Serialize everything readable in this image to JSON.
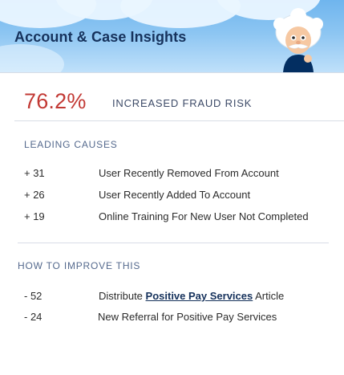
{
  "header": {
    "title": "Account & Case Insights",
    "mascot": "einstein-mascot-icon"
  },
  "metric": {
    "value": "76.2%",
    "label": "INCREASED FRAUD RISK",
    "color": "#c23934"
  },
  "leading_causes": {
    "title": "LEADING CAUSES",
    "items": [
      {
        "score": "+ 31",
        "text": "User Recently Removed From Account"
      },
      {
        "score": "+ 26",
        "text": "User Recently Added To Account"
      },
      {
        "score": "+ 19",
        "text": "Online Training For New User Not Completed"
      }
    ]
  },
  "improve": {
    "title": "HOW TO IMPROVE THIS",
    "items": [
      {
        "score": "- 52",
        "prefix": "Distribute ",
        "link": "Positive Pay Services",
        "suffix": " Article"
      },
      {
        "score": "- 24",
        "text": "New Referral for Positive Pay Services"
      }
    ]
  }
}
